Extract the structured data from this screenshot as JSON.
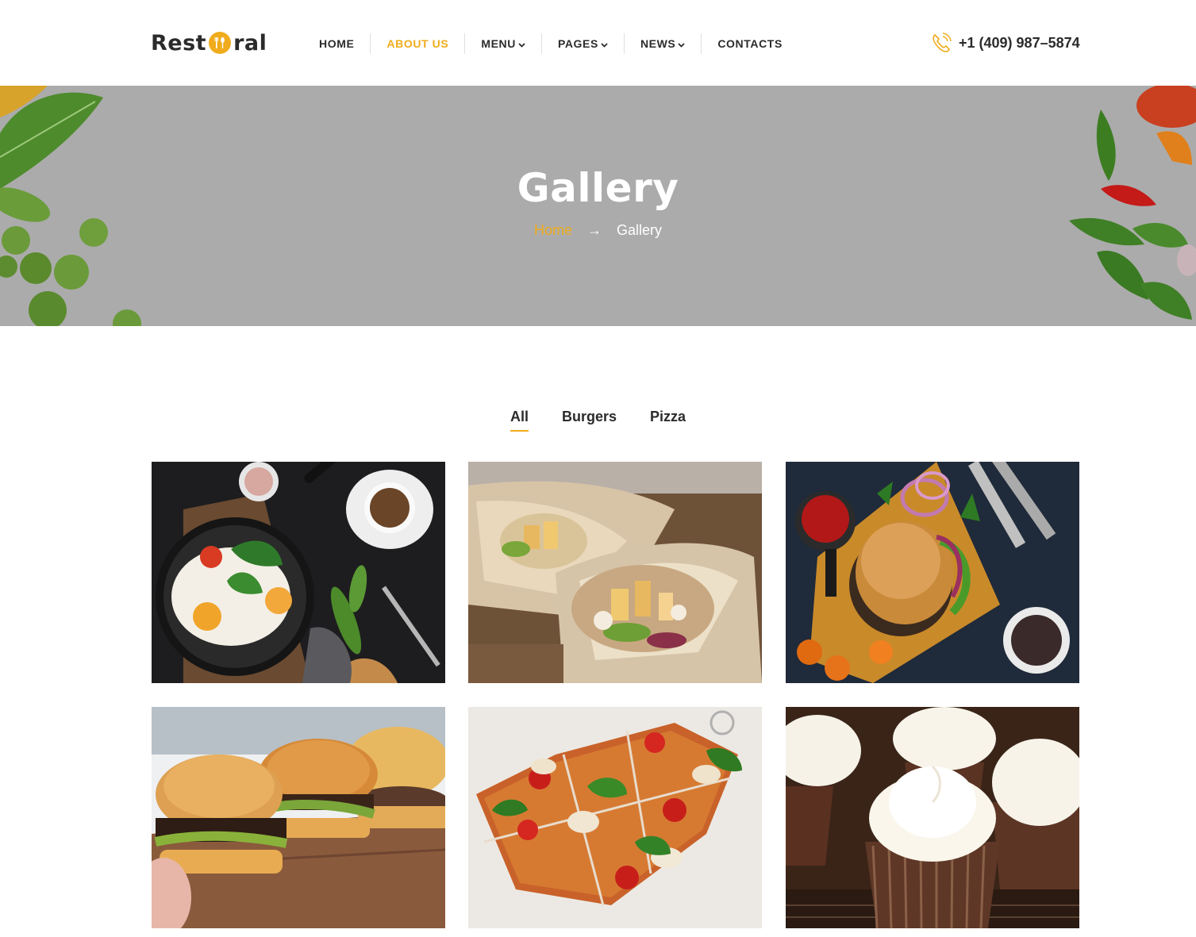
{
  "brand": {
    "logo_left": "Rest",
    "logo_right": "ral"
  },
  "nav": {
    "items": [
      {
        "label": "HOME",
        "has_dropdown": false,
        "active": false
      },
      {
        "label": "ABOUT US",
        "has_dropdown": false,
        "active": true
      },
      {
        "label": "MENU",
        "has_dropdown": true,
        "active": false
      },
      {
        "label": "PAGES",
        "has_dropdown": true,
        "active": false
      },
      {
        "label": "NEWS",
        "has_dropdown": true,
        "active": false
      },
      {
        "label": "CONTACTS",
        "has_dropdown": false,
        "active": false
      }
    ]
  },
  "header": {
    "phone": "+1 (409) 987–5874",
    "phone_icon": "phone-icon"
  },
  "hero": {
    "title": "Gallery",
    "breadcrumb": {
      "home": "Home",
      "separator": "→",
      "current": "Gallery"
    }
  },
  "filters": {
    "items": [
      "All",
      "Burgers",
      "Pizza"
    ],
    "active": "All"
  },
  "gallery": {
    "items": [
      {
        "subject": "breakfast-pan-eggs"
      },
      {
        "subject": "chicken-wraps"
      },
      {
        "subject": "burger-on-board"
      },
      {
        "subject": "burgers-on-wood"
      },
      {
        "subject": "pizza-slices"
      },
      {
        "subject": "cupcakes"
      }
    ]
  },
  "colors": {
    "accent": "#f0ac1d",
    "text": "#2b2b2b",
    "hero_bg": "#ababab",
    "white": "#ffffff"
  }
}
